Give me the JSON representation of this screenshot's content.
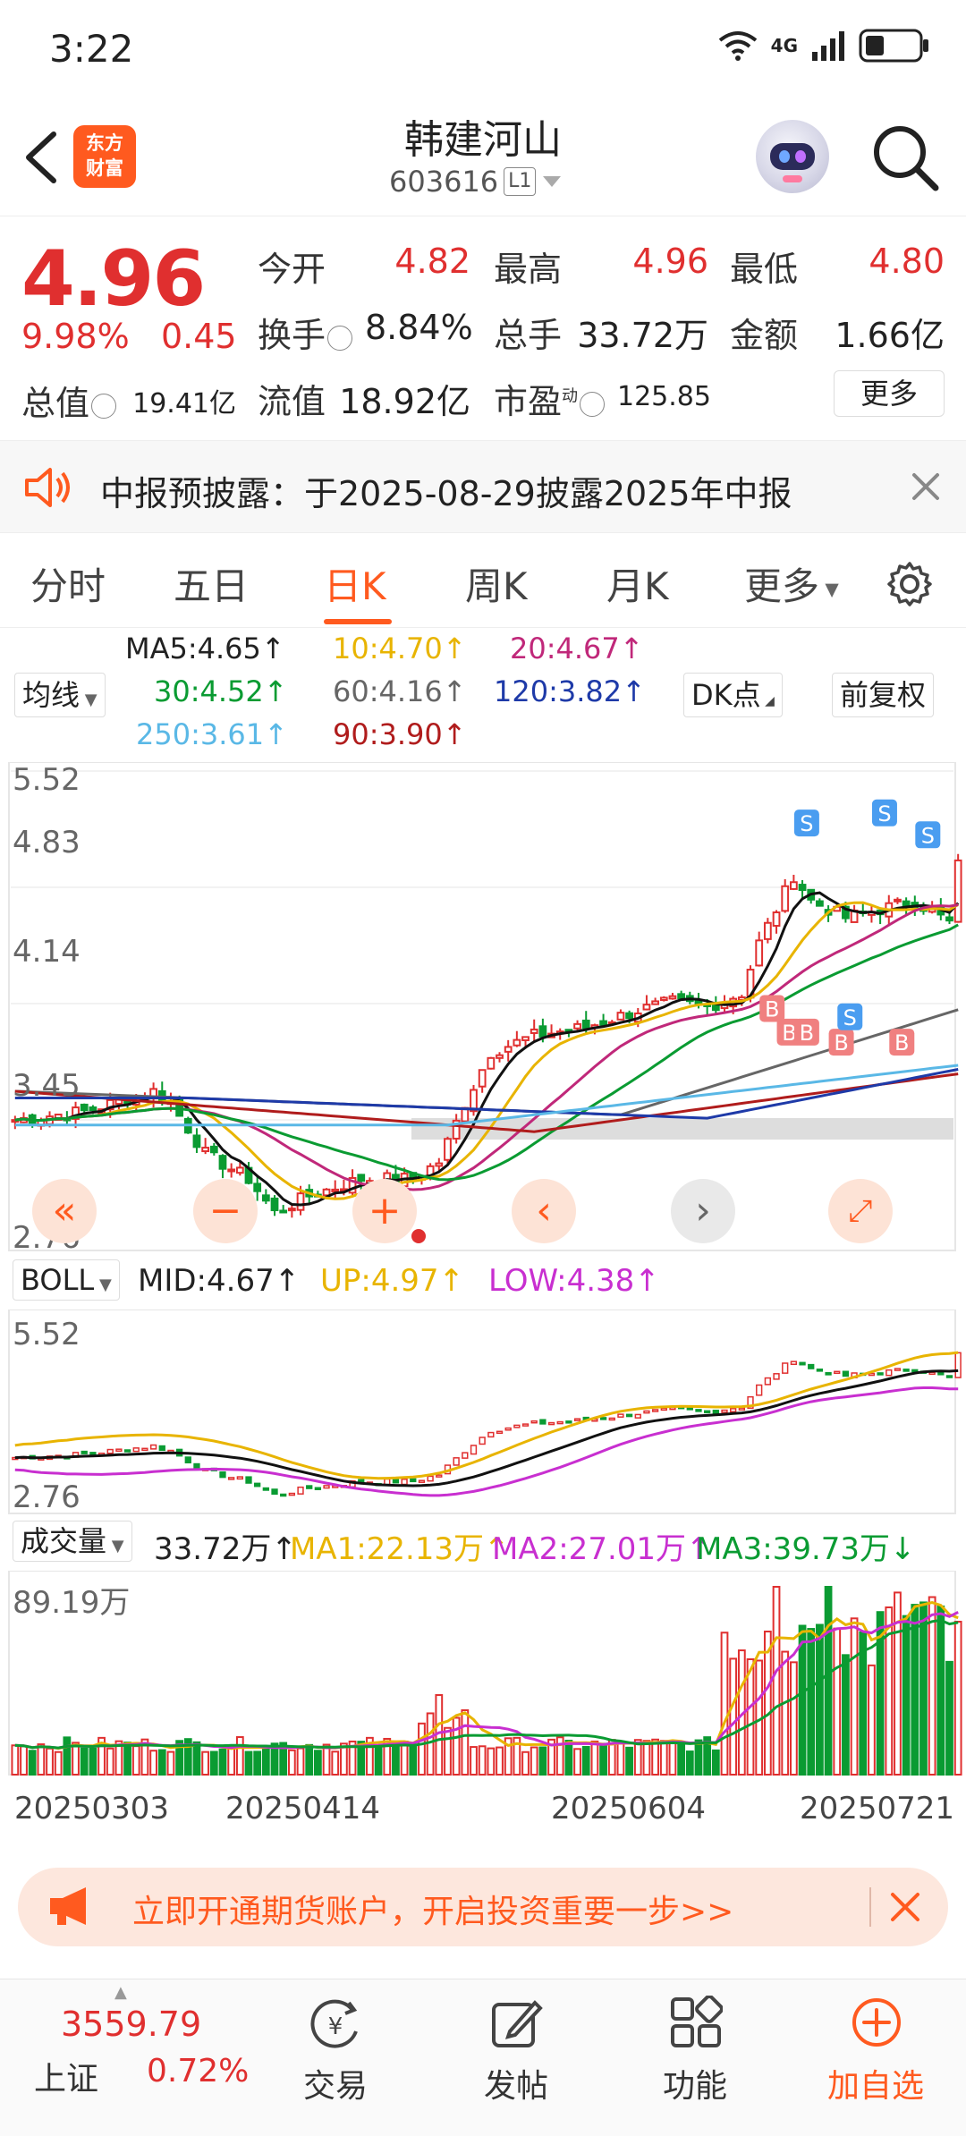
{
  "status_bar": {
    "time": "3:22",
    "network": "4G"
  },
  "header": {
    "back_icon": "back-arrow-icon",
    "logo_text_line1": "东方",
    "logo_text_line2": "财富",
    "stock_name": "韩建河山",
    "stock_code": "603616",
    "level_badge": "L1"
  },
  "quote": {
    "price": "4.96",
    "change_pct": "9.98%",
    "change": "0.45",
    "open_label": "今开",
    "open": "4.82",
    "high_label": "最高",
    "high": "4.96",
    "low_label": "最低",
    "low": "4.80",
    "turnover_label": "换手",
    "turnover": "8.84%",
    "volume_label": "总手",
    "volume": "33.72万",
    "amount_label": "金额",
    "amount": "1.66亿",
    "mkt_cap_label": "总值",
    "mkt_cap": "19.41亿",
    "float_cap_label": "流值",
    "float_cap": "18.92亿",
    "pe_label": "市盈",
    "pe_sup": "动",
    "pe": "125.85",
    "more_label": "更多"
  },
  "notice": {
    "text": "中报预披露：于2025-08-29披露2025年中报"
  },
  "tabs": [
    "分时",
    "五日",
    "日K",
    "周K",
    "月K",
    "更多"
  ],
  "active_tab": "日K",
  "ma_legend": {
    "ma5": "MA5:4.65↑",
    "ma10": "10:4.70↑",
    "ma20": "20:4.67↑",
    "ma30": "30:4.52↑",
    "ma60": "60:4.16↑",
    "ma120": "120:3.82↑",
    "ma250": "250:3.61↑",
    "ma90": "90:3.90↑",
    "junxian_label": "均线",
    "dk_label": "DK点",
    "fq_label": "前复权"
  },
  "kline_axis": {
    "top": "5.52",
    "l2": "4.83",
    "l3": "4.14",
    "l4": "3.45",
    "bottom": "2.76"
  },
  "boll": {
    "label": "BOLL",
    "mid": "MID:4.67↑",
    "up": "UP:4.97↑",
    "low": "LOW:4.38↑",
    "top": "5.52",
    "bottom": "2.76"
  },
  "vol": {
    "label": "成交量",
    "value": "33.72万↑",
    "ma1": "MA1:22.13万↑",
    "ma2": "MA2:27.01万↑",
    "ma3": "MA3:39.73万↓",
    "top": "89.19万"
  },
  "dates": [
    "20250303",
    "20250414",
    "20250604",
    "20250721"
  ],
  "ad": {
    "text": "立即开通期货账户，开启投资重要一步>>"
  },
  "bottom_nav": {
    "index_value": "3559.79",
    "index_name": "上证",
    "index_pct": "0.72%",
    "trade": "交易",
    "post": "发帖",
    "func": "功能",
    "add": "加自选"
  },
  "colors": {
    "up": "#e02f2f",
    "down": "#0a9b32",
    "accent": "#ff5a1f"
  }
}
